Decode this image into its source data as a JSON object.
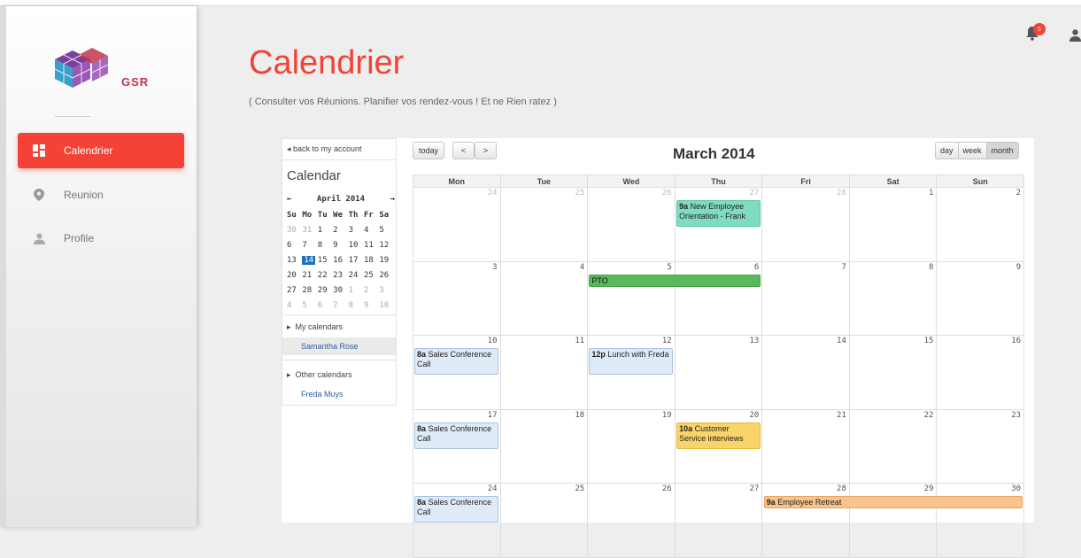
{
  "brand": {
    "name": "GSR",
    "logo_icon": "cube-logo-icon",
    "color": "#c0354c"
  },
  "sidebar": {
    "items": [
      {
        "label": "Calendrier",
        "icon": "dashboard-icon",
        "active": true
      },
      {
        "label": "Reunion",
        "icon": "location-pin-icon",
        "active": false
      },
      {
        "label": "Profile",
        "icon": "person-icon",
        "active": false
      }
    ]
  },
  "header": {
    "title": "Calendrier",
    "subtitle": "( Consulter vos Réunions. Planifier vos rendez-vous ! Et ne Rien ratez )",
    "notifications_count": "5",
    "accent": "#f44336"
  },
  "calendar_app": {
    "back_link": "◂ back to my account",
    "panel_title": "Calendar",
    "mini": {
      "prev": "←",
      "next": "→",
      "month_label": "April 2014",
      "dow": [
        "Su",
        "Mo",
        "Tu",
        "We",
        "Th",
        "Fr",
        "Sa"
      ],
      "weeks": [
        [
          "30",
          "31",
          "1",
          "2",
          "3",
          "4",
          "5"
        ],
        [
          "6",
          "7",
          "8",
          "9",
          "10",
          "11",
          "12"
        ],
        [
          "13",
          "14",
          "15",
          "16",
          "17",
          "18",
          "19"
        ],
        [
          "20",
          "21",
          "22",
          "23",
          "24",
          "25",
          "26"
        ],
        [
          "27",
          "28",
          "29",
          "30",
          "1",
          "2",
          "3"
        ],
        [
          "4",
          "5",
          "6",
          "7",
          "8",
          "9",
          "10"
        ]
      ],
      "today": "14"
    },
    "my_calendars_label": "My calendars",
    "my_calendars": [
      "Samantha Rose"
    ],
    "other_calendars_label": "Other calendars",
    "other_calendars": [
      "Freda Muys"
    ],
    "toolbar": {
      "today": "today",
      "prev": "<",
      "next": ">"
    },
    "month_title": "March 2014",
    "views": [
      "day",
      "week",
      "month"
    ],
    "active_view": "month",
    "dow_headers": [
      "Mon",
      "Tue",
      "Wed",
      "Thu",
      "Fri",
      "Sat",
      "Sun"
    ],
    "weeks": [
      {
        "days": [
          "24",
          "25",
          "26",
          "27",
          "28",
          "1",
          "2"
        ],
        "other": [
          true,
          true,
          true,
          true,
          true,
          false,
          false
        ]
      },
      {
        "days": [
          "3",
          "4",
          "5",
          "6",
          "7",
          "8",
          "9"
        ],
        "other": [
          false,
          false,
          false,
          false,
          false,
          false,
          false
        ]
      },
      {
        "days": [
          "10",
          "11",
          "12",
          "13",
          "14",
          "15",
          "16"
        ],
        "other": [
          false,
          false,
          false,
          false,
          false,
          false,
          false
        ]
      },
      {
        "days": [
          "17",
          "18",
          "19",
          "20",
          "21",
          "22",
          "23"
        ],
        "other": [
          false,
          false,
          false,
          false,
          false,
          false,
          false
        ]
      },
      {
        "days": [
          "24",
          "25",
          "26",
          "27",
          "28",
          "29",
          "30"
        ],
        "other": [
          false,
          false,
          false,
          false,
          false,
          false,
          false
        ]
      }
    ],
    "events": [
      {
        "week": 0,
        "col": 3,
        "span": 1,
        "time": "9a",
        "title": "New Employee Orientation - Frank",
        "color": "teal"
      },
      {
        "week": 1,
        "col": 2,
        "span": 2,
        "time": "",
        "title": "PTO",
        "color": "green"
      },
      {
        "week": 2,
        "col": 0,
        "span": 1,
        "time": "8a",
        "title": "Sales Conference Call",
        "color": "blue"
      },
      {
        "week": 2,
        "col": 2,
        "span": 1,
        "time": "12p",
        "title": "Lunch with Freda",
        "color": "blue"
      },
      {
        "week": 3,
        "col": 0,
        "span": 1,
        "time": "8a",
        "title": "Sales Conference Call",
        "color": "blue"
      },
      {
        "week": 3,
        "col": 3,
        "span": 1,
        "time": "10a",
        "title": "Customer Service interviews",
        "color": "yellow"
      },
      {
        "week": 4,
        "col": 0,
        "span": 1,
        "time": "8a",
        "title": "Sales Conference Call",
        "color": "blue"
      },
      {
        "week": 4,
        "col": 4,
        "span": 3,
        "time": "9a",
        "title": "Employee Retreat",
        "color": "orange"
      }
    ]
  }
}
